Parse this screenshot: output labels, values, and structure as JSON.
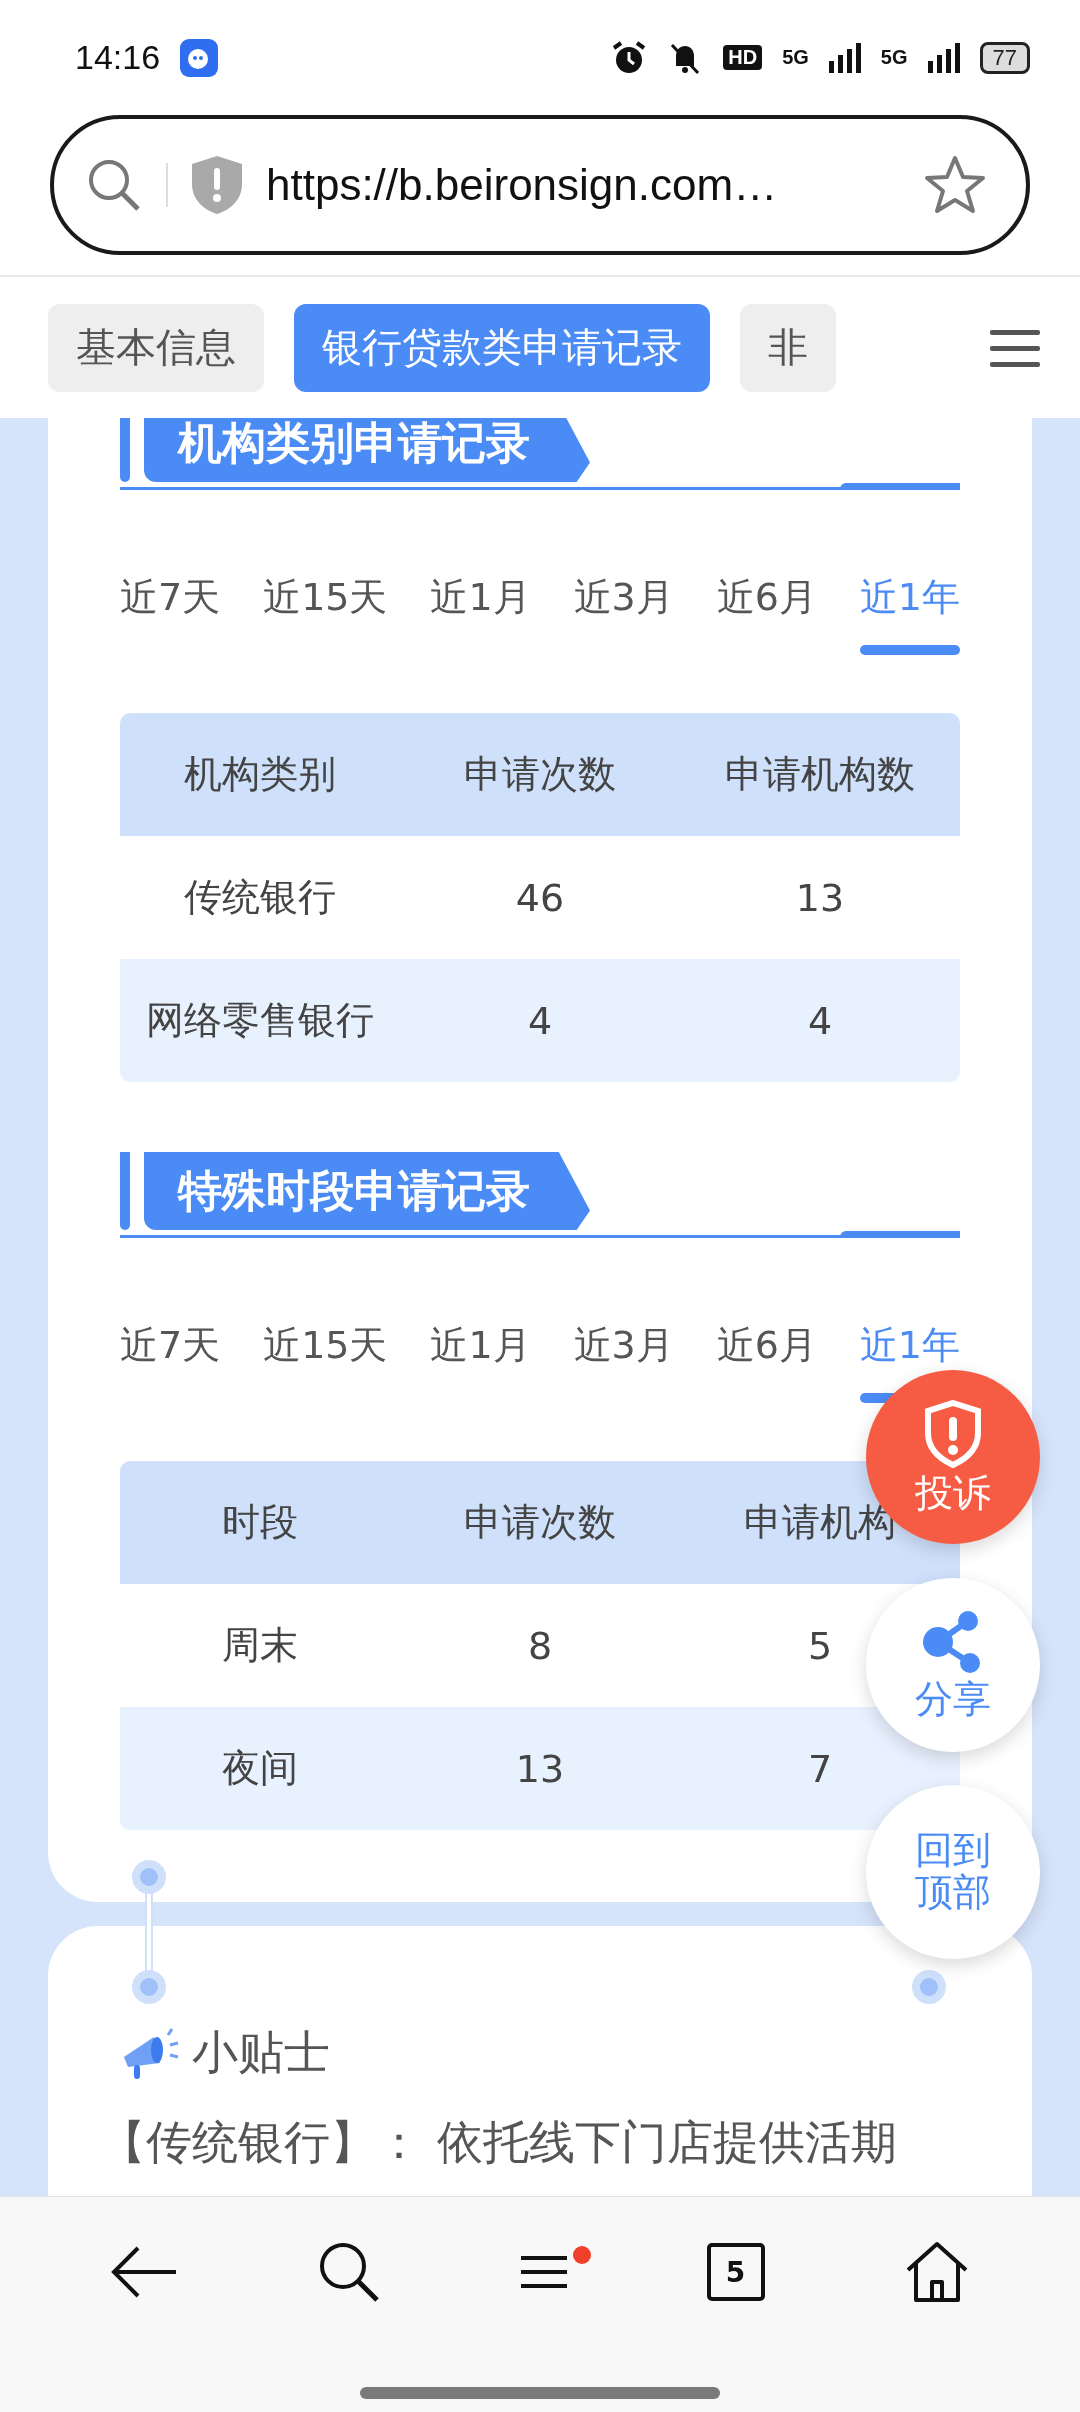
{
  "status_bar": {
    "time": "14:16",
    "hd": "HD",
    "sims": [
      "5G",
      "5G"
    ],
    "battery": "77"
  },
  "address_bar": {
    "url": "https://b.beironsign.com…"
  },
  "tabs": [
    {
      "label": "基本信息",
      "selected": false
    },
    {
      "label": "银行贷款类申请记录",
      "selected": true
    },
    {
      "label": "非",
      "selected": false
    }
  ],
  "sections": [
    {
      "title": "机构类别申请记录",
      "periods": [
        {
          "label": "近7天",
          "selected": false
        },
        {
          "label": "近15天",
          "selected": false
        },
        {
          "label": "近1月",
          "selected": false
        },
        {
          "label": "近3月",
          "selected": false
        },
        {
          "label": "近6月",
          "selected": false
        },
        {
          "label": "近1年",
          "selected": true
        }
      ],
      "table": {
        "columns": [
          "机构类别",
          "申请次数",
          "申请机构数"
        ],
        "rows": [
          [
            "传统银行",
            "46",
            "13"
          ],
          [
            "网络零售银行",
            "4",
            "4"
          ]
        ]
      }
    },
    {
      "title": "特殊时段申请记录",
      "periods": [
        {
          "label": "近7天",
          "selected": false
        },
        {
          "label": "近15天",
          "selected": false
        },
        {
          "label": "近1月",
          "selected": false
        },
        {
          "label": "近3月",
          "selected": false
        },
        {
          "label": "近6月",
          "selected": false
        },
        {
          "label": "近1年",
          "selected": true
        }
      ],
      "table": {
        "columns": [
          "时段",
          "申请次数",
          "申请机构"
        ],
        "rows": [
          [
            "周末",
            "8",
            "5"
          ],
          [
            "夜间",
            "13",
            "7"
          ]
        ]
      }
    }
  ],
  "tips": {
    "title": "小贴士",
    "text": "【传统银行】： 依托线下门店提供活期"
  },
  "floating_buttons": [
    {
      "kind": "complaint",
      "label": "投诉"
    },
    {
      "kind": "share",
      "label": "分享"
    },
    {
      "kind": "top",
      "label": "回到顶部"
    }
  ],
  "bottom_nav": {
    "tab_count": "5",
    "menu_notification": true
  }
}
